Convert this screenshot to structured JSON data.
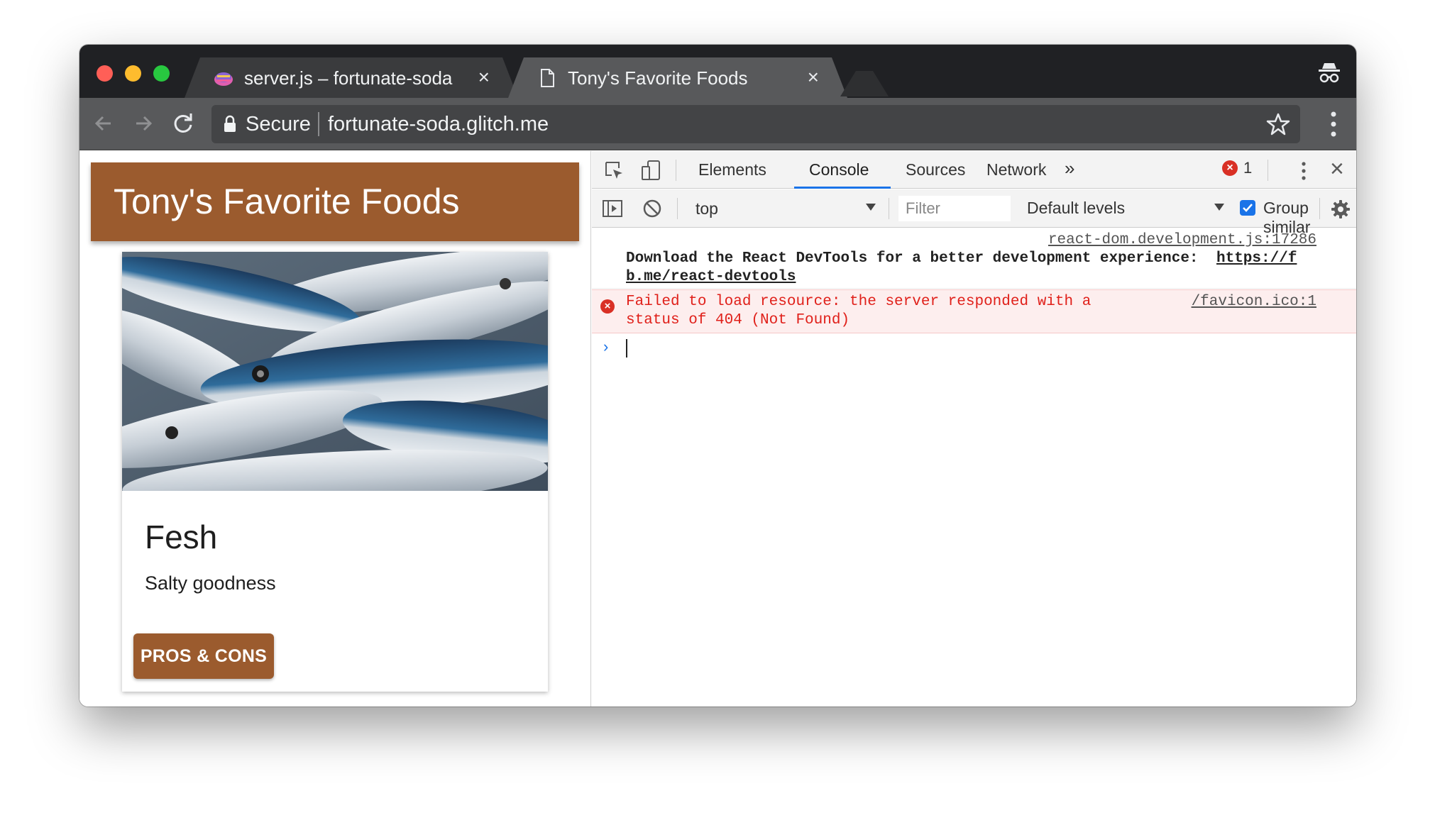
{
  "window": {
    "tabs": [
      {
        "title": "server.js – fortunate-soda",
        "icon": "glitch-icon",
        "active": false
      },
      {
        "title": "Tony's Favorite Foods",
        "icon": "document-icon",
        "active": true
      }
    ],
    "tab_close_glyph": "×"
  },
  "toolbar": {
    "security_label": "Secure",
    "url": "fortunate-soda.glitch.me"
  },
  "page": {
    "header_title": "Tony's Favorite Foods",
    "card": {
      "title": "Fesh",
      "description": "Salty goodness",
      "button_label": "PROS & CONS",
      "image_subject": "fresh mackerel fish"
    },
    "accent_color": "#9b5b2e"
  },
  "devtools": {
    "tabs": [
      "Elements",
      "Console",
      "Sources",
      "Network"
    ],
    "active_tab": "Console",
    "more_tabs_glyph": "»",
    "error_count": "1",
    "context": "top",
    "filter_placeholder": "Filter",
    "levels_label": "Default levels",
    "group_similar_label": "Group similar",
    "group_similar_checked": true,
    "messages": {
      "info": {
        "source": "react-dom.development.js:17286",
        "line1": "Download the React DevTools for a better development experience: ",
        "link_part1": "https://f",
        "link_part2": "b.me/react-devtools"
      },
      "error": {
        "line1": "Failed to load resource: the server responded with a",
        "line2": "status of 404 (Not Found)",
        "source": "/favicon.ico:1"
      }
    },
    "prompt_glyph": "›"
  }
}
